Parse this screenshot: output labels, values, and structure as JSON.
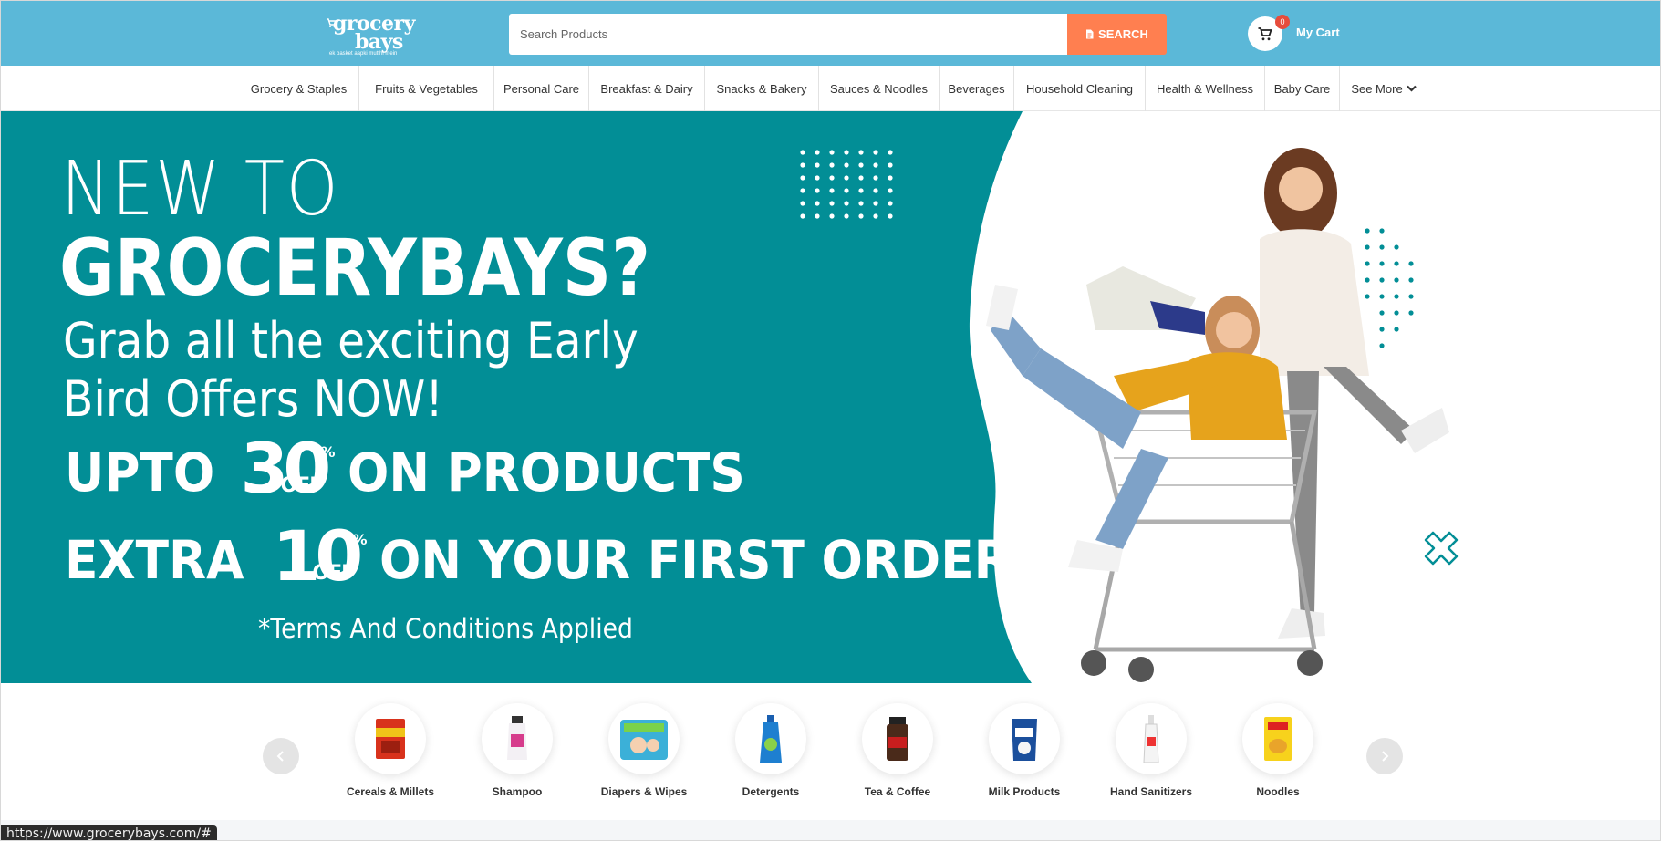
{
  "header": {
    "logo": {
      "line1": "grocery",
      "line2": "bays",
      "tagline": "ek basket aapki mutthi mein"
    },
    "search": {
      "placeholder": "Search Products",
      "button_label": "SEARCH"
    },
    "cart": {
      "count": "0",
      "label": "My Cart"
    }
  },
  "categories_nav": [
    {
      "label": "Grocery & Staples"
    },
    {
      "label": "Fruits & Vegetables"
    },
    {
      "label": "Personal Care"
    },
    {
      "label": "Breakfast & Dairy"
    },
    {
      "label": "Snacks & Bakery"
    },
    {
      "label": "Sauces & Noodles"
    },
    {
      "label": "Beverages"
    },
    {
      "label": "Household Cleaning"
    },
    {
      "label": "Health & Wellness"
    },
    {
      "label": "Baby Care"
    },
    {
      "label": "See More"
    }
  ],
  "banner": {
    "line1": "NEW TO",
    "line2": "GROCERYBAYS?",
    "line3": "Grab all the exciting Early Bird Offers NOW!",
    "offer1": {
      "prefix": "UPTO",
      "value": "30",
      "percent": "%",
      "off": "OFF",
      "suffix": "ON PRODUCTS"
    },
    "offer2": {
      "prefix": "EXTRA",
      "value": "10",
      "percent": "%",
      "off": "OFF",
      "suffix": "ON YOUR FIRST ORDER"
    },
    "terms": "*Terms And Conditions Applied",
    "colors": {
      "background": "#028e96",
      "blob": "#ffffff"
    }
  },
  "featured_categories": [
    {
      "label": "Cereals & Millets",
      "icon": "cereal-pack-icon"
    },
    {
      "label": "Shampoo",
      "icon": "shampoo-bottle-icon"
    },
    {
      "label": "Diapers & Wipes",
      "icon": "diaper-pack-icon"
    },
    {
      "label": "Detergents",
      "icon": "detergent-bottle-icon"
    },
    {
      "label": "Tea & Coffee",
      "icon": "coffee-jar-icon"
    },
    {
      "label": "Milk Products",
      "icon": "milk-pouch-icon"
    },
    {
      "label": "Hand Sanitizers",
      "icon": "sanitizer-bottle-icon"
    },
    {
      "label": "Noodles",
      "icon": "noodles-pack-icon"
    }
  ],
  "status_bar": {
    "url": "https://www.grocerybays.com/#"
  },
  "theme": {
    "header_bg": "#5bb8d8",
    "search_button": "#ff7f50",
    "badge": "#e74c3c"
  }
}
